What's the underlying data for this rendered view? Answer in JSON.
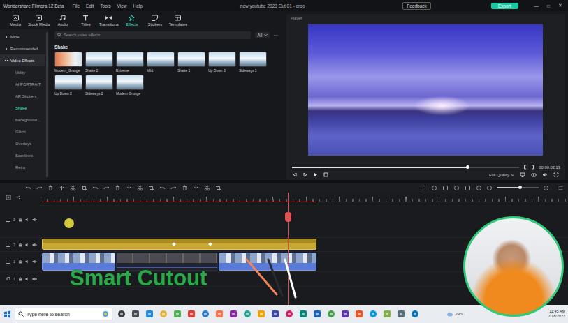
{
  "titlebar": {
    "app_name": "Wondershare Filmora 12 Beta",
    "menus": [
      "File",
      "Edit",
      "Tools",
      "View",
      "Help"
    ],
    "project": "new youtube 2023 Cut 01 - crop",
    "feedback": "Feedback",
    "export": "Export",
    "window_controls": [
      "—",
      "□",
      "✕"
    ]
  },
  "toolbar": {
    "tabs": [
      {
        "label": "Media",
        "selected": false
      },
      {
        "label": "Stock Media",
        "selected": false
      },
      {
        "label": "Audio",
        "selected": false
      },
      {
        "label": "Titles",
        "selected": false
      },
      {
        "label": "Transitions",
        "selected": false
      },
      {
        "label": "Effects",
        "selected": true
      },
      {
        "label": "Stickers",
        "selected": false
      },
      {
        "label": "Templates",
        "selected": false
      }
    ]
  },
  "sidebar": {
    "items": [
      {
        "label": "Mine",
        "kind": "group",
        "expanded": false,
        "selected": false
      },
      {
        "label": "Recommended",
        "kind": "group",
        "expanded": false,
        "selected": false
      },
      {
        "label": "Video Effects",
        "kind": "group",
        "expanded": true,
        "selected": false
      },
      {
        "label": "Utility",
        "kind": "sub",
        "expanded": false,
        "selected": false
      },
      {
        "label": "AI PORTRAIT",
        "kind": "sub",
        "expanded": false,
        "selected": false
      },
      {
        "label": "AR Stickers",
        "kind": "sub",
        "expanded": false,
        "selected": false
      },
      {
        "label": "Shake",
        "kind": "sub",
        "expanded": false,
        "selected": true
      },
      {
        "label": "Background...",
        "kind": "sub",
        "expanded": false,
        "selected": false
      },
      {
        "label": "Glitch",
        "kind": "sub",
        "expanded": false,
        "selected": false
      },
      {
        "label": "Overlays",
        "kind": "sub",
        "expanded": false,
        "selected": false
      },
      {
        "label": "Scanlines",
        "kind": "sub",
        "expanded": false,
        "selected": false
      },
      {
        "label": "Retro",
        "kind": "sub",
        "expanded": false,
        "selected": false
      }
    ]
  },
  "library": {
    "search": {
      "placeholder": "Search video effects"
    },
    "filter": "All",
    "more": "···",
    "section": "Shake",
    "effects": [
      {
        "label": "Modern_Grunge",
        "kind": "grunge"
      },
      {
        "label": "Shake 2",
        "kind": "landscape"
      },
      {
        "label": "Extreme",
        "kind": "landscape"
      },
      {
        "label": "Mild",
        "kind": "landscape"
      },
      {
        "label": "Shake 1",
        "kind": "landscape"
      },
      {
        "label": "Up Down 3",
        "kind": "landscape"
      },
      {
        "label": "Sideways 1",
        "kind": "landscape"
      },
      {
        "label": "Up Down 2",
        "kind": "landscape"
      },
      {
        "label": "Sideways 2",
        "kind": "landscape"
      },
      {
        "label": "Modern Grunge",
        "kind": "landscape"
      }
    ]
  },
  "player": {
    "label": "Player",
    "progress": 0.77,
    "time": "00:00:02:13",
    "quality": "Full Quality"
  },
  "timeline": {
    "zoom": 0.55,
    "playhead": 0.469,
    "tracks": [
      {
        "number": "3",
        "kind": "empty"
      },
      {
        "number": "2",
        "kind": "effect"
      },
      {
        "number": "1",
        "kind": "video"
      },
      {
        "number": "1",
        "kind": "audio"
      }
    ]
  },
  "overlay": {
    "caption": "Smart Cutout"
  },
  "taskbar": {
    "search": {
      "placeholder": "Type here to search"
    },
    "weather": "29°C",
    "time": "11:45 AM",
    "date": "7/18/2023"
  }
}
